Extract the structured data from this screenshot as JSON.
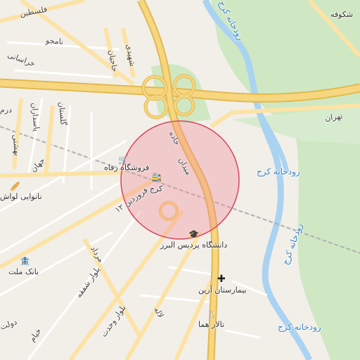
{
  "map": {
    "colors": {
      "background": "#f2efe9",
      "park": "#cfe8c3",
      "water": "#aad3f2",
      "highway": "#f7d680",
      "highway_casing": "#e2b94f",
      "road": "#fce3a5",
      "minor_road": "#ffffff",
      "railway": "#b0b0b0",
      "circle_fill": "#f08a99",
      "circle_stroke": "#d9455d"
    },
    "places": {
      "refah_store": "فروشگاه رفاه",
      "karaj": "کرج",
      "alborz_campus": "دانشگاه پردیس البرز",
      "arian_hospital": "بیمارستان آرین",
      "homa_hall": "تالار هما",
      "mellat_bank": "بانک ملت",
      "bakery": "نانوایی لواش",
      "shokoofeh": "شکوفه"
    },
    "rivers": {
      "label_top": "رودخانه کرج",
      "label_mid": "رودخانه کرج",
      "label_right": "رودخانه کرج",
      "label_bottom": "رودخانه کرج"
    },
    "roads": {
      "tehran": "تهران",
      "farvardin": "فروردین ۱۲",
      "mordad": "مرداد",
      "boulevard_shafagh": "بلوار شفقه",
      "boulevard_vahdat": "بلوار وحدت",
      "khorasani": "خراسانی",
      "namjoo": "نامجو",
      "hajinian": "حاجیان",
      "shahidi": "شهیدی",
      "golestan": "گلستان",
      "pasdaran": "پاسداران",
      "beheshti": "بهشتی",
      "jahan": "جهان",
      "khayyam": "خیام",
      "dolat": "دولت",
      "lale": "لاله",
      "galaxy_top": "فلسطین",
      "dar": "درم",
      "jadeh": "جاده",
      "meydan": "میدان"
    },
    "icons": {
      "store": "shopping-cart-icon",
      "station": "train-icon",
      "university": "graduation-cap-icon",
      "hospital": "hospital-cross-icon",
      "restaurant": "fork-knife-icon",
      "bank": "bank-icon",
      "bakery": "bakery-icon"
    }
  }
}
